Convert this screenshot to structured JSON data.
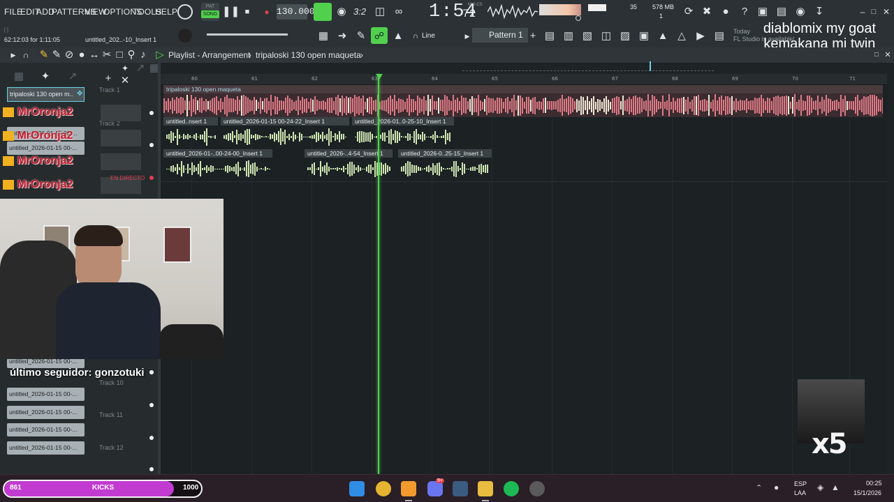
{
  "menu": {
    "items": [
      "FILE",
      "EDIT",
      "ADD",
      "PATTERNS",
      "VIEW",
      "OPTIONS",
      "TOOLS",
      "HELP"
    ],
    "pat_song_top": "PAT",
    "pat_song_bottom": "SONG"
  },
  "transport": {
    "tempo": "130.000",
    "time_main": "1:54",
    "time_sub": "72",
    "time_unit": "M:S:CS",
    "numeric_display": "3:2",
    "cpu_value": "35",
    "ram": "578 MB",
    "poly": "1"
  },
  "hint": {
    "position": "62:12:03 for 1:11:05",
    "channel": "untitled_202..-10_Insert 1"
  },
  "toolbar2": {
    "snap": "Line",
    "pattern": "Pattern 1",
    "news_date": "Today",
    "news_text": "FL Studio is available!"
  },
  "playlist": {
    "title": "Playlist - Arrangement",
    "arrangement": "tripaloski 130 open maqueta",
    "selected_pattern": "tripaloski 130 open m..",
    "bar_numbers": [
      "60",
      "61",
      "62",
      "63",
      "64",
      "65",
      "66",
      "67",
      "68",
      "69",
      "70",
      "71"
    ]
  },
  "tracks": {
    "labels": [
      "Track 1",
      "Track 2",
      "Track 10",
      "Track 11",
      "Track 12"
    ],
    "clips": {
      "main": "tripaloski 130 open maqueta",
      "t2": [
        "untitled..nsert 1",
        "untitled_2026-01-15 00-24-22_Insert 1",
        "untitled_2026-01..0-25-10_Insert 1"
      ],
      "t3": [
        "untitled_2026-01-..00-24-00_Insert 1",
        "untitled_2026-..4-54_Insert 1",
        "untitled_2026-0..25-15_Insert 1"
      ]
    },
    "pattern_chips": [
      "untitled_2026-01-15 00-...",
      "untitled_2026-01-15 00-...",
      "untitled_2026-01-15 00-...",
      "untitled_2026-01-15 00-...",
      "untitled_2026-01-15 00-...",
      "untitled_2026-01-15 00-...",
      "untitled_2026-01-15 00-..."
    ]
  },
  "stream": {
    "kick_user": "MrOronja2",
    "overlay_line1": "diablomix my goat",
    "overlay_line2": "kemakana mi twin",
    "follower": "último seguidor: gonzotuki",
    "multiplier": "x5",
    "live_badge": "EN DIRECTO"
  },
  "kick_goal": {
    "current": "861",
    "label": "KICKS",
    "target": "1000",
    "fraction": 0.861,
    "color": "#c23bd1"
  },
  "taskbar": {
    "lang1": "ESP",
    "lang2": "LAA",
    "clock_time": "00:25",
    "clock_date": "15/1/2026",
    "discord_badge": "9+"
  },
  "colors": {
    "accent_green": "#51d04e",
    "clip_main": "#e07a86",
    "clip_audio": "#cfe6b2"
  }
}
